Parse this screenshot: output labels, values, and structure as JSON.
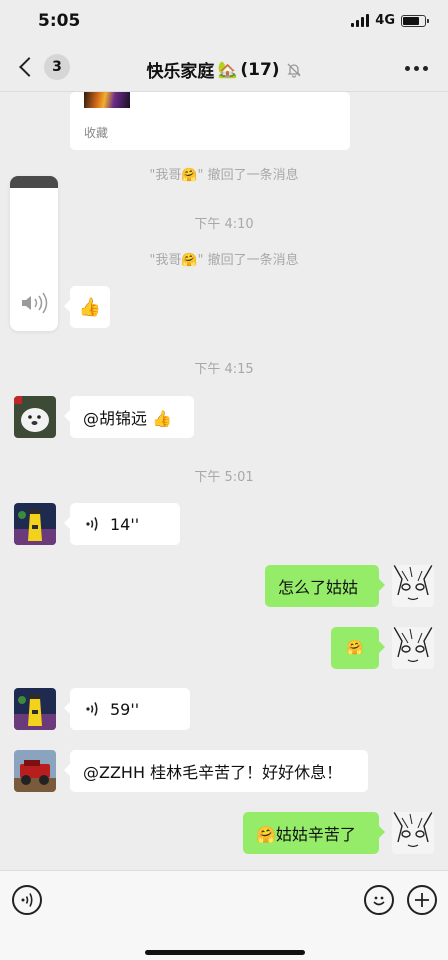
{
  "status_bar": {
    "time": "5:05",
    "network": "4G",
    "signal_bars": 4,
    "battery_level": 0.75
  },
  "nav": {
    "unread_count": "3",
    "title": "快乐家庭",
    "title_icon": "house-with-tree-icon",
    "member_count": "(17)",
    "mute_icon": "bell-slash-icon",
    "more_icon": "ellipsis-icon"
  },
  "messages": {
    "card_tag": "收藏",
    "recall_1": "\"我哥🤗\" 撤回了一条消息",
    "time_1": "下午 4:10",
    "recall_2": "\"我哥🤗\" 撤回了一条消息",
    "thumbs_up": "👍",
    "time_2": "下午 4:15",
    "mention_text": "@胡锦远 👍",
    "time_3": "下午 5:01",
    "voice_1_duration": "14''",
    "reply_1": "怎么了姑姑",
    "reply_2_emoji": "🤗",
    "voice_2_duration": "59''",
    "mention_zzhh": "@ZZHH 桂林毛辛苦了！好好休息！",
    "reply_3": "🤗姑姑辛苦了"
  },
  "input_bar": {
    "voice_icon": "voice-input-icon",
    "emoji_icon": "smiley-icon",
    "plus_icon": "plus-icon"
  },
  "colors": {
    "background": "#ededed",
    "bubble_self": "#95ec69",
    "bubble_other": "#ffffff",
    "system_text": "#a8a8a8"
  }
}
